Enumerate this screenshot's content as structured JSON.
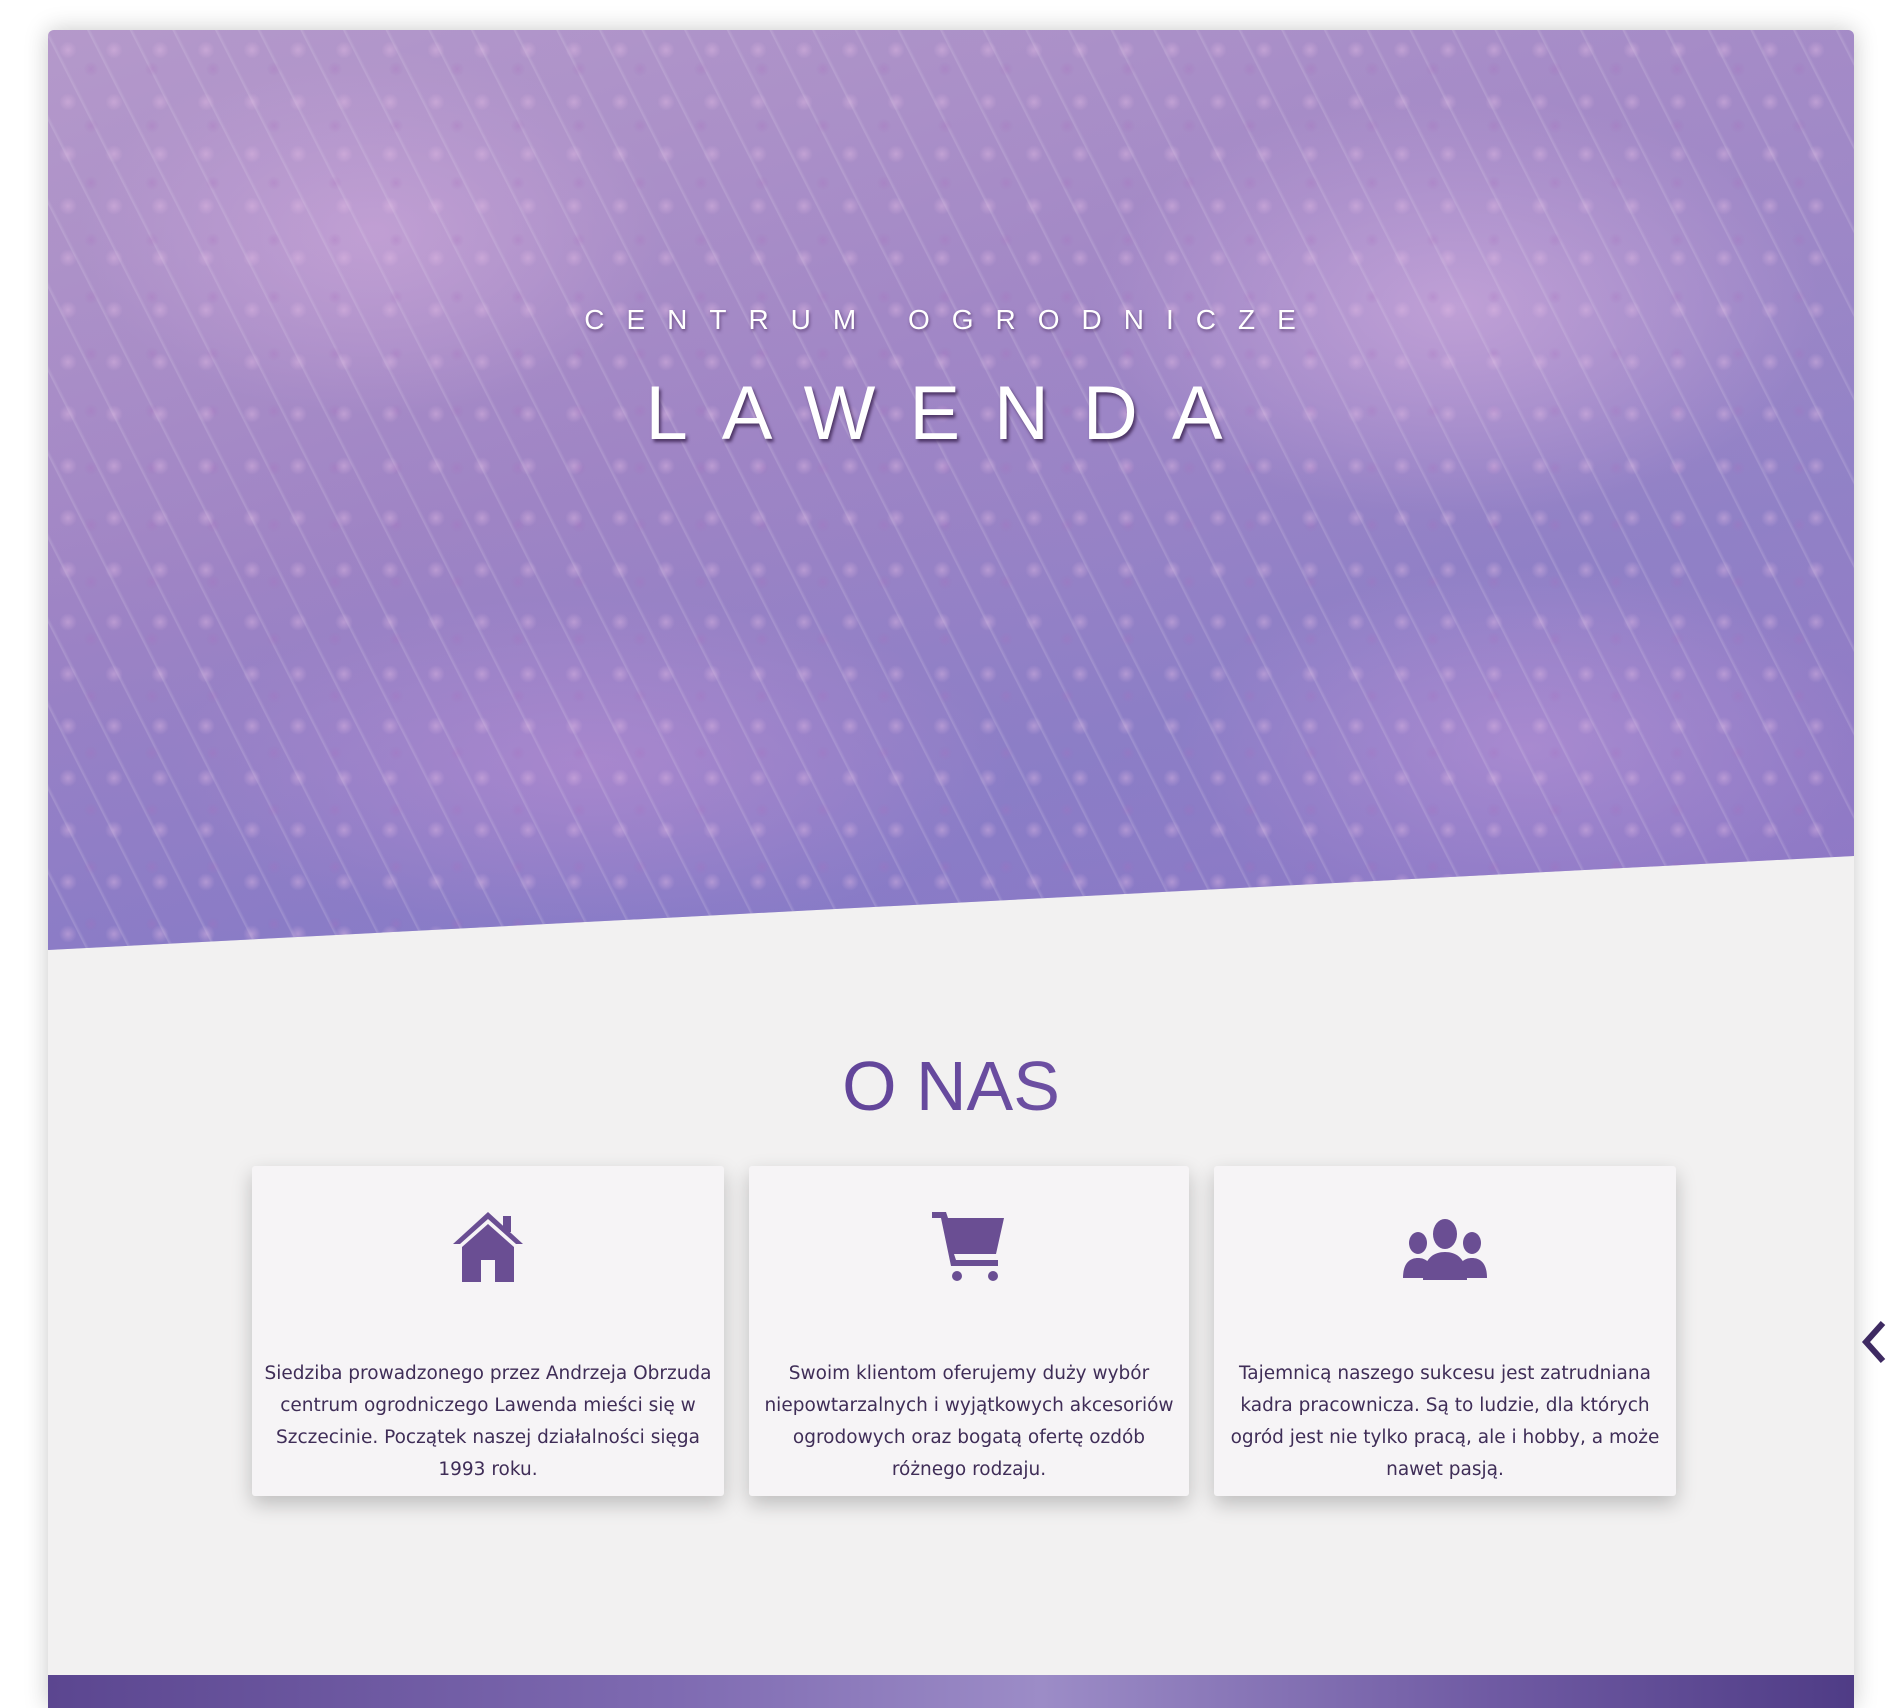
{
  "hero": {
    "subtitle": "CENTRUM OGRODNICZE",
    "title": "LAWENDA"
  },
  "about": {
    "title": "O NAS",
    "cards": [
      {
        "icon": "home-icon",
        "text": "Siedziba prowadzonego przez Andrzeja Obrzuda centrum ogrodniczego Lawenda mieści się w Szczecinie. Początek naszej działalności sięga 1993 roku."
      },
      {
        "icon": "cart-icon",
        "text": "Swoim klientom oferujemy duży wybór niepowtarzalnych i wyjątkowych akcesoriów ogrodowych oraz bogatą ofertę ozdób różnego rodzaju."
      },
      {
        "icon": "users-icon",
        "text": "Tajemnicą naszego sukcesu jest zatrudniana kadra pracownicza. Są to ludzie, dla których ogród jest nie tylko pracą, ale i hobby, a może nawet pasją."
      }
    ]
  },
  "nav": {
    "icon": "chevron-left-icon"
  },
  "colors": {
    "accent": "#6a4e93",
    "title_start": "#4b2f78",
    "title_end": "#9a7cc4",
    "text": "#3f2d57",
    "background": "#f2f1f1"
  }
}
